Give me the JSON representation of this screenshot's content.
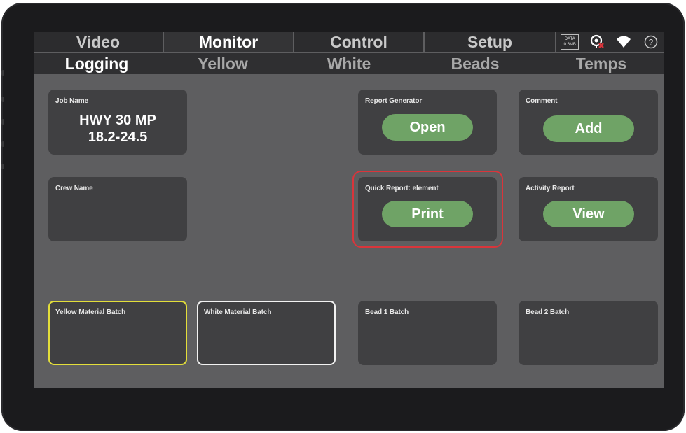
{
  "tabs": [
    {
      "label": "Video",
      "active": false
    },
    {
      "label": "Monitor",
      "active": true
    },
    {
      "label": "Control",
      "active": false
    },
    {
      "label": "Setup",
      "active": false
    }
  ],
  "status": {
    "data_label": "DATA",
    "data_size": "0.6MB",
    "icons": [
      "location-error-icon",
      "wifi-icon",
      "help-icon"
    ],
    "help_glyph": "?"
  },
  "subtabs": [
    {
      "label": "Logging",
      "active": true
    },
    {
      "label": "Yellow",
      "active": false
    },
    {
      "label": "White",
      "active": false
    },
    {
      "label": "Beads",
      "active": false
    },
    {
      "label": "Temps",
      "active": false
    }
  ],
  "panels": {
    "job_name": {
      "title": "Job Name",
      "line1": "HWY 30 MP",
      "line2": "18.2-24.5"
    },
    "crew_name": {
      "title": "Crew Name"
    },
    "report_generator": {
      "title": "Report Generator",
      "button": "Open"
    },
    "comment": {
      "title": "Comment",
      "button": "Add"
    },
    "quick_report": {
      "title": "Quick Report: element",
      "button": "Print"
    },
    "activity_report": {
      "title": "Activity Report",
      "button": "View"
    },
    "yellow_batch": {
      "title": "Yellow Material Batch"
    },
    "white_batch": {
      "title": "White Material Batch"
    },
    "bead1_batch": {
      "title": "Bead 1 Batch"
    },
    "bead2_batch": {
      "title": "Bead 2 Batch"
    }
  },
  "colors": {
    "accent_green": "#6fa366",
    "highlight_red": "#d9353b",
    "yellow_border": "#e3de3a",
    "white_border": "#f2f2f2"
  }
}
